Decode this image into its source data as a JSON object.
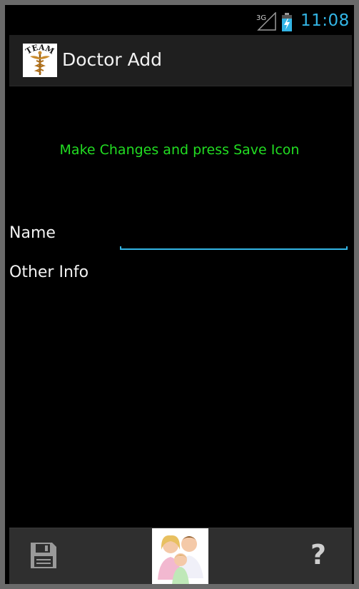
{
  "status_bar": {
    "time": "11:08",
    "network_type": "3G",
    "signal_icon": "signal-icon",
    "battery_icon": "battery-charging-icon",
    "time_color": "#33b5e5"
  },
  "action_bar": {
    "logo_icon": "team-caduceus-logo",
    "logo_text": "TEAM",
    "title": "Doctor Add"
  },
  "form": {
    "hint": "Make Changes and press Save Icon",
    "hint_color": "#22dd22",
    "name_label": "Name",
    "name_value": "",
    "other_info_label": "Other Info"
  },
  "bottom_bar": {
    "save_icon": "save-icon",
    "family_icon": "family-image",
    "help_label": "?",
    "accent_color": "#33b5e5"
  }
}
